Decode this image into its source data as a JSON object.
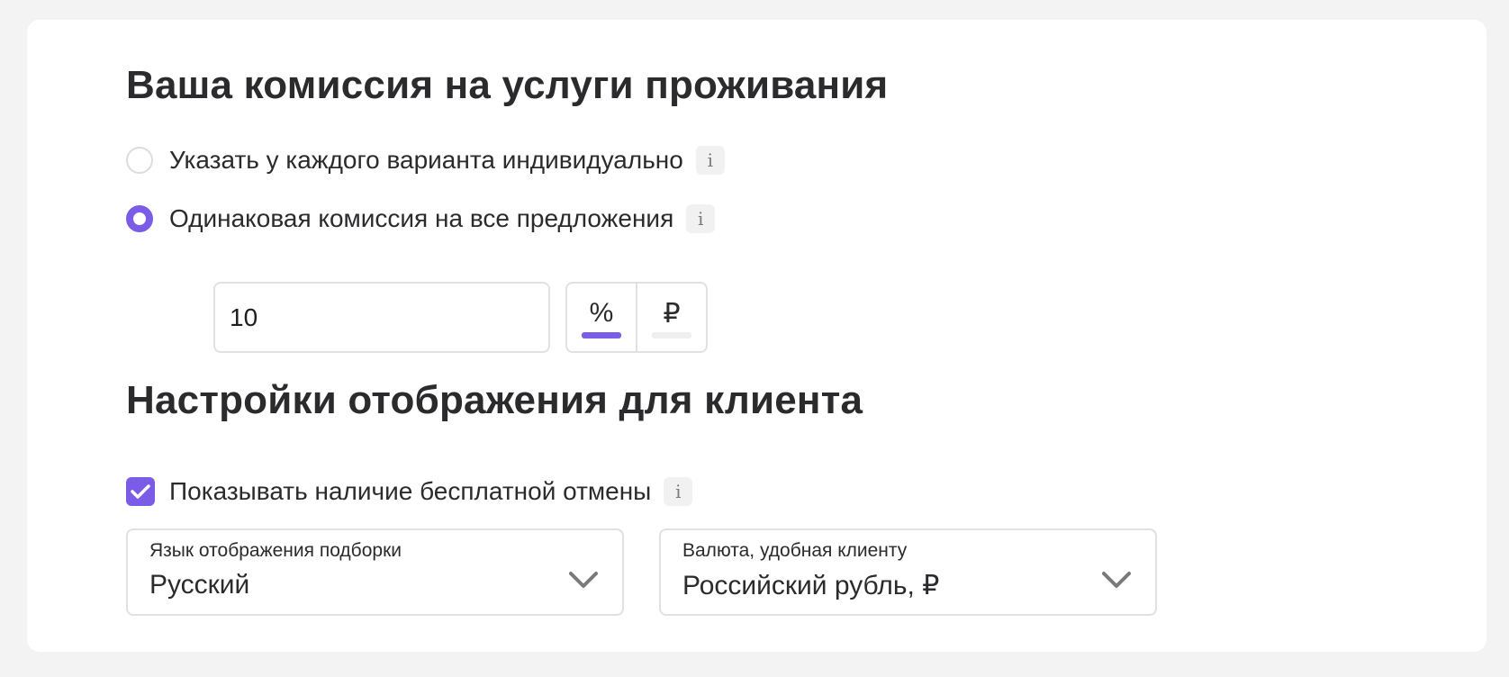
{
  "commission": {
    "title": "Ваша комиссия на услуги проживания",
    "options": [
      {
        "label": "Указать у каждого варианта индивидуально",
        "selected": false,
        "info_icon": "i"
      },
      {
        "label": "Одинаковая комиссия на все предложения",
        "selected": true,
        "info_icon": "i"
      }
    ],
    "amount_value": "10",
    "units": [
      {
        "label": "%",
        "active": true
      },
      {
        "label": "₽",
        "active": false
      }
    ]
  },
  "display": {
    "title": "Настройки отображения для клиента",
    "free_cancel": {
      "label": "Показывать наличие бесплатной отмены",
      "checked": true,
      "info_icon": "i"
    },
    "language_select": {
      "caption": "Язык отображения подборки",
      "value": "Русский"
    },
    "currency_select": {
      "caption": "Валюта, удобная клиенту",
      "value": "Российский рубль, ₽"
    }
  },
  "colors": {
    "accent": "#7b5ce6",
    "background": "#f3f3f3",
    "card": "#ffffff",
    "border": "#e1e1e1"
  },
  "icons": {
    "info": "info-icon",
    "check": "check-icon",
    "chevron": "chevron-down-icon"
  }
}
